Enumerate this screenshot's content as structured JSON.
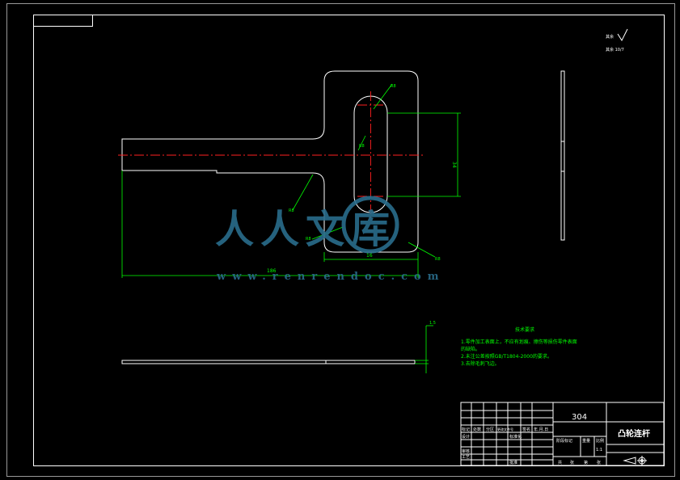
{
  "roughness": {
    "symbol": "√",
    "label_top": "其余",
    "label_bottom": "其余 10/7"
  },
  "tech": {
    "title": "技术要求",
    "items": [
      "1.零件加工表面上，不应有划痕、擦伤等损伤零件表面",
      "的缺陷。",
      "2.未注公差按照GB/T1804-2000的要求。",
      "3.去除毛刺飞边。"
    ]
  },
  "title_block": {
    "material": "304",
    "part_name": "凸轮连杆",
    "scale": "1:1",
    "row_labels_a": [
      "标记",
      "处数",
      "分区",
      "更改文件号",
      "签名",
      "年.月.日"
    ],
    "design": "设计",
    "standard": "标准化",
    "stage_mark": "阶段标记",
    "weight": "重量",
    "ratio": "比例",
    "review": "审核",
    "process": "工艺",
    "approve": "批准",
    "sheets": [
      "共",
      "张",
      "第",
      "张"
    ]
  },
  "dims": {
    "length": "186",
    "slot_width": "16",
    "slot_length": "34",
    "r_top": "R8",
    "r_mid": "R8",
    "r_left": "R8",
    "r_right": "R8",
    "hole": "R8",
    "thickness": "1.5"
  },
  "watermark": {
    "text": "人人文库",
    "url": "www.renrendoc.com"
  }
}
